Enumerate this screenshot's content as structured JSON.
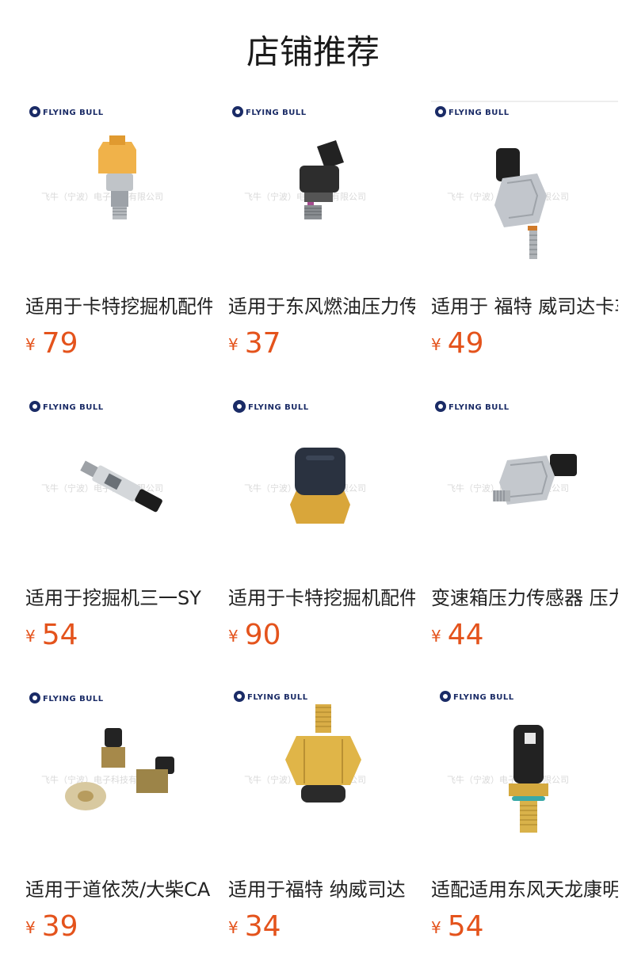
{
  "header": {
    "title": "店铺推荐"
  },
  "brand": {
    "logo_text": "FLYING BULL",
    "watermark": "飞牛（宁波）电子科技有限公司"
  },
  "currency": "¥",
  "products": [
    {
      "name": "适用于卡特挖掘机配件",
      "price": "79",
      "image": "yellow-cap-sensor"
    },
    {
      "name": "适用于东风燃油压力传感器",
      "price": "37",
      "image": "black-connector-sensor"
    },
    {
      "name": "适用于 福特 威司达卡车",
      "price": "49",
      "image": "silver-hex-sensor"
    },
    {
      "name": "适用于挖掘机三一SY",
      "price": "54",
      "image": "slim-tube-sensor"
    },
    {
      "name": "适用于卡特挖掘机配件",
      "price": "90",
      "image": "brass-large-connector-sensor"
    },
    {
      "name": "变速箱压力传感器 压力",
      "price": "44",
      "image": "silver-side-connector-sensor"
    },
    {
      "name": "适用于道依茨/大柴CA",
      "price": "39",
      "image": "multi-sensor-kit"
    },
    {
      "name": "适用于福特 纳威司达",
      "price": "34",
      "image": "brass-hex-sensor"
    },
    {
      "name": "适配适用东风天龙康明斯",
      "price": "54",
      "image": "black-body-oring-sensor"
    }
  ]
}
